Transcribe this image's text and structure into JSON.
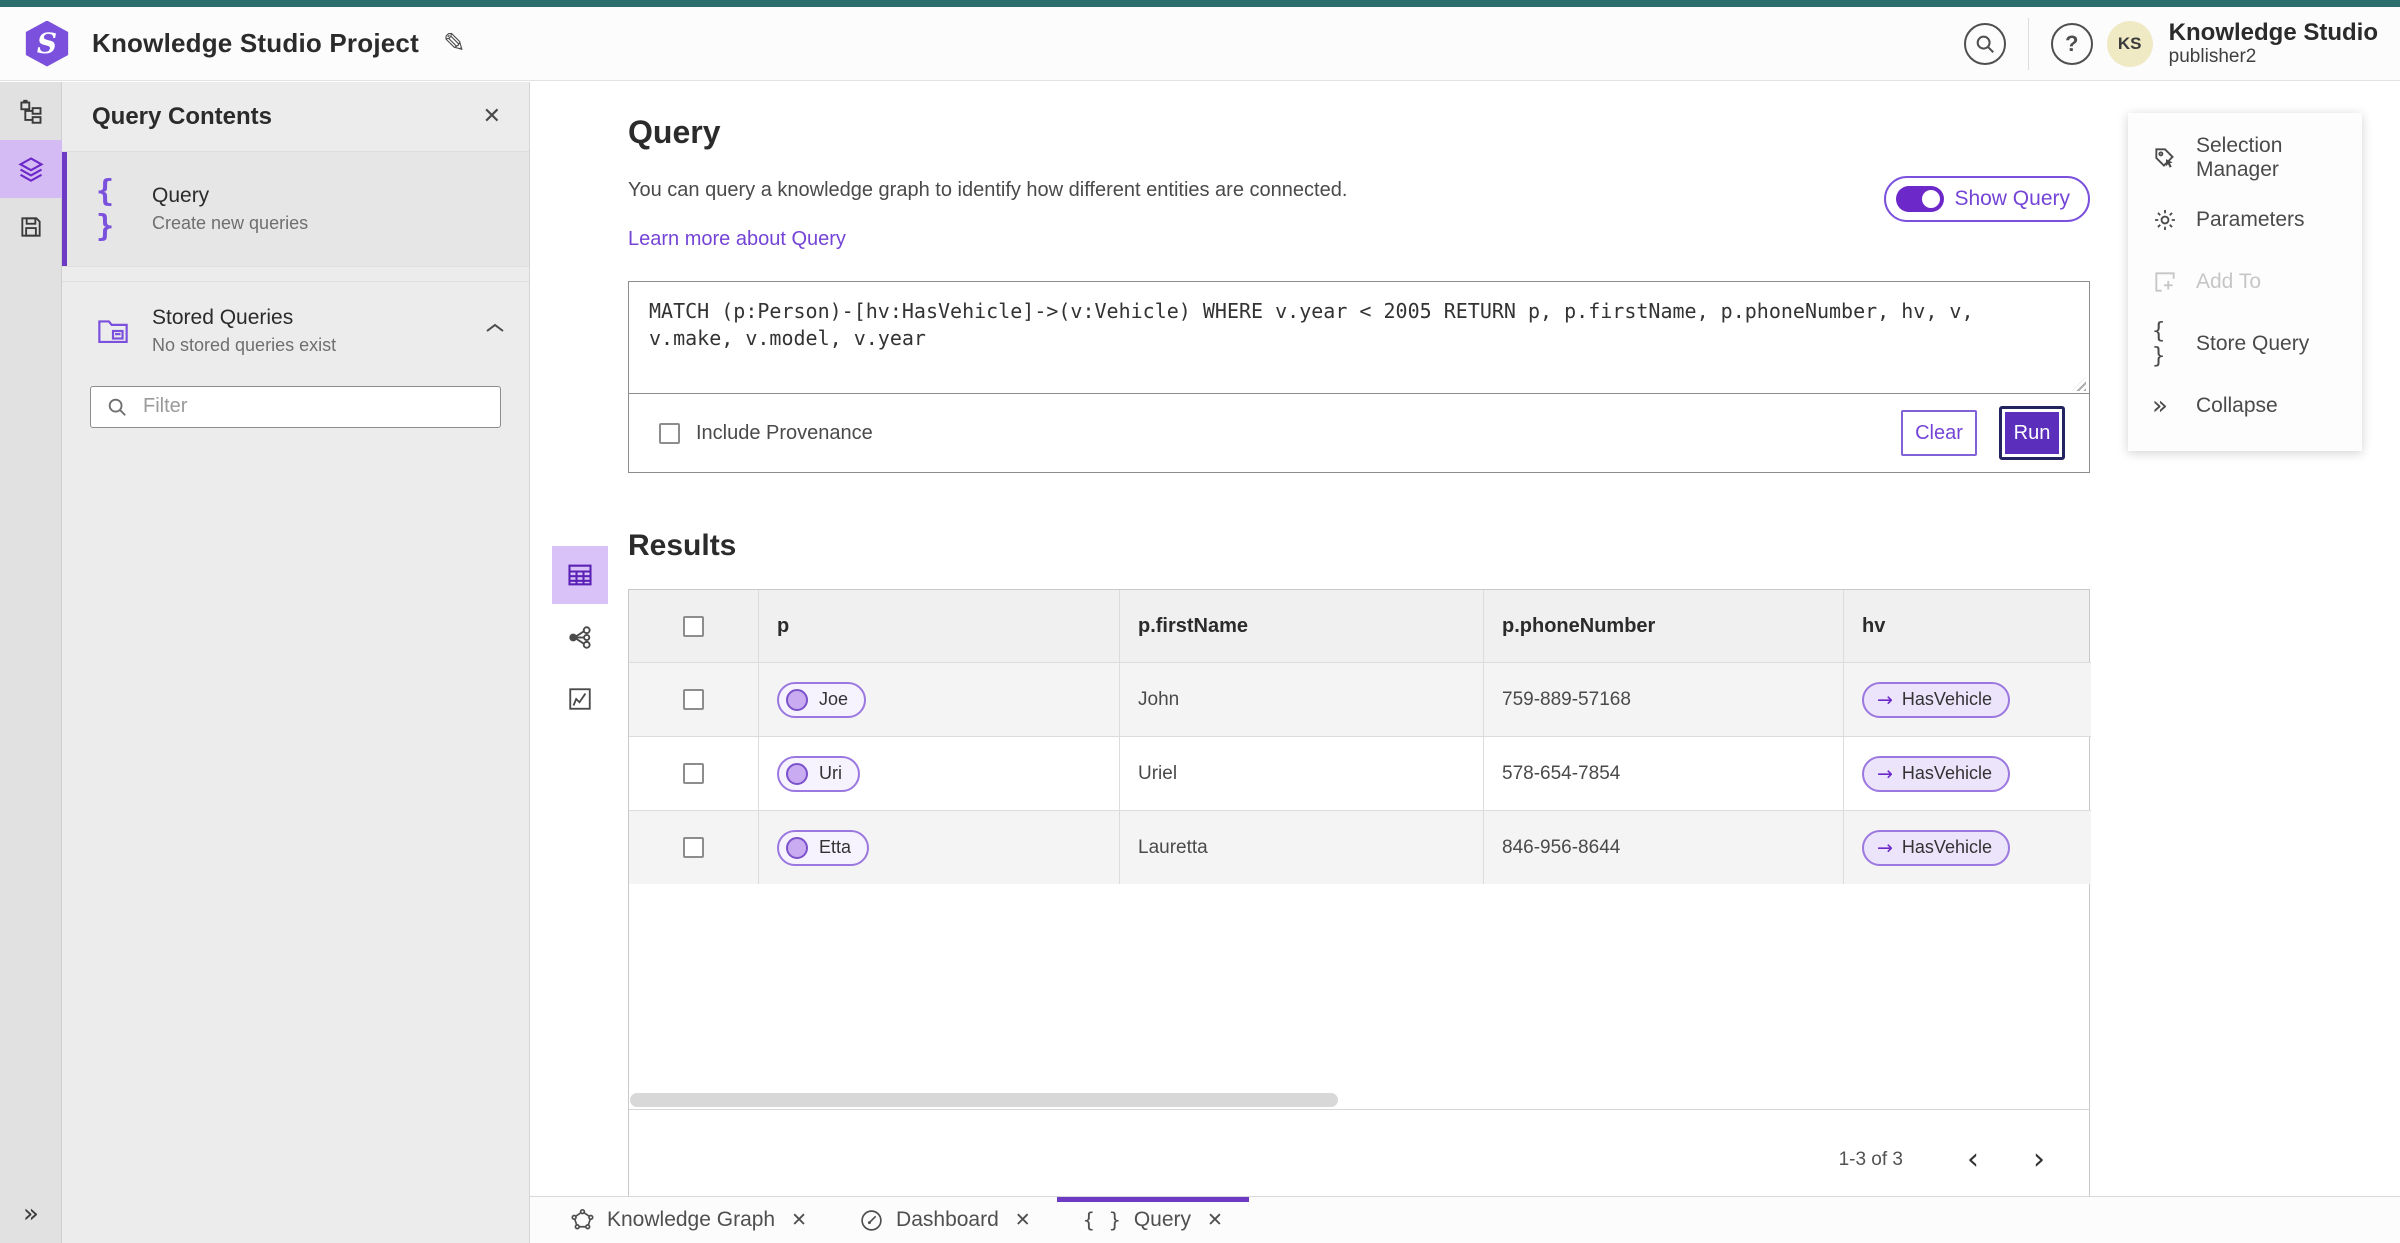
{
  "colors": {
    "accent": "#6d3ac4",
    "accent_deep": "#5b2ebc",
    "teal_topline": "#2c6e6e",
    "active_icon_bg": "#d4bbf4",
    "pill_border": "#9b78e0",
    "pill_entity_bg": "#f6f2fe",
    "pill_relation_bg": "#ece4fb",
    "avatar_bg": "#efe9c4"
  },
  "icons": {
    "close": "✕",
    "pencil": "✎",
    "help": "?",
    "collapse": "»",
    "expand": "»",
    "prev": "‹",
    "next": "›",
    "arrow_right": "→",
    "braces": "{ }"
  },
  "header": {
    "title": "Knowledge Studio Project",
    "product": "Knowledge Studio",
    "username": "publisher2",
    "avatar_initials": "KS"
  },
  "panel": {
    "title": "Query Contents",
    "query_item": {
      "title": "Query",
      "subtitle": "Create new queries"
    },
    "stored_item": {
      "title": "Stored Queries",
      "subtitle": "No stored queries exist"
    },
    "filter_placeholder": "Filter"
  },
  "query": {
    "heading": "Query",
    "description": "You can query a knowledge graph to identify how different entities are connected.",
    "learn_link": "Learn more about Query",
    "toggle_label": "Show Query",
    "code": "MATCH (p:Person)-[hv:HasVehicle]->(v:Vehicle) WHERE v.year < 2005 RETURN p, p.firstName, p.phoneNumber, hv, v,\nv.make, v.model, v.year",
    "provenance_label": "Include Provenance",
    "clear_label": "Clear",
    "run_label": "Run"
  },
  "tools": {
    "items": [
      {
        "label": "Selection Manager"
      },
      {
        "label": "Parameters"
      },
      {
        "label": "Add To"
      },
      {
        "label": "Store Query"
      },
      {
        "label": "Collapse"
      }
    ]
  },
  "results": {
    "heading": "Results",
    "columns": {
      "c1": "p",
      "c2": "p.firstName",
      "c3": "p.phoneNumber",
      "c4": "hv"
    },
    "rows": [
      {
        "p": "Joe",
        "firstName": "John",
        "phoneNumber": "759-889-57168",
        "hv": "HasVehicle"
      },
      {
        "p": "Uri",
        "firstName": "Uriel",
        "phoneNumber": "578-654-7854",
        "hv": "HasVehicle"
      },
      {
        "p": "Etta",
        "firstName": "Lauretta",
        "phoneNumber": "846-956-8644",
        "hv": "HasVehicle"
      }
    ],
    "pagination_range": "1-3 of 3"
  },
  "tabs": {
    "knowledge_graph": "Knowledge Graph",
    "dashboard": "Dashboard",
    "query": "Query"
  }
}
